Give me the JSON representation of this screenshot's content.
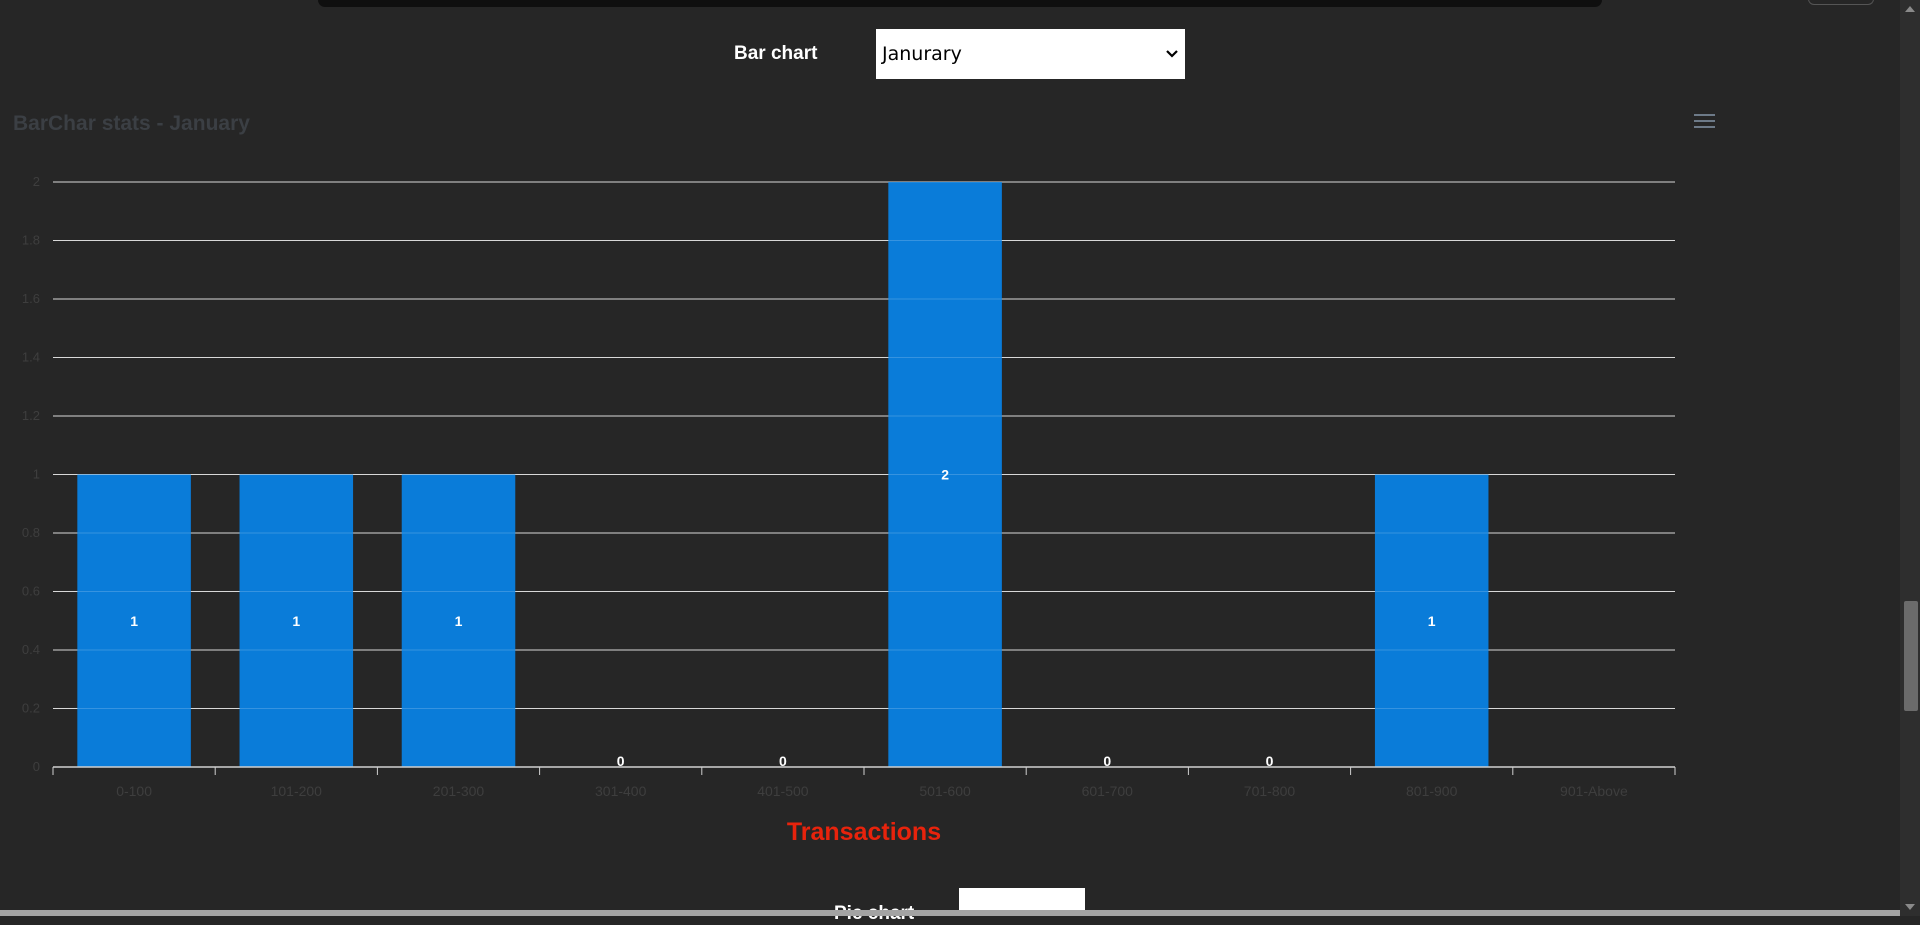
{
  "controls": {
    "bar_label": "Bar chart",
    "month_selected": "Janurary",
    "pie_label": "Pie chart"
  },
  "chart_data": {
    "type": "bar",
    "title": "BarChar stats - January",
    "categories": [
      "0-100",
      "101-200",
      "201-300",
      "301-400",
      "401-500",
      "501-600",
      "601-700",
      "701-800",
      "801-900",
      "901-Above"
    ],
    "values": [
      1,
      1,
      1,
      0,
      0,
      2,
      0,
      0,
      1,
      null
    ],
    "data_labels": [
      "1",
      "1",
      "1",
      "0",
      "0",
      "2",
      "0",
      "0",
      "1",
      ""
    ],
    "xlabel": "Transactions",
    "ylabel": "",
    "ylim": [
      0,
      2
    ],
    "yticks": [
      "0",
      "0.2",
      "0.4",
      "0.6",
      "0.8",
      "1",
      "1.2",
      "1.4",
      "1.6",
      "1.8",
      "2"
    ],
    "grid": true,
    "colors": {
      "bar": "#0a7cd9",
      "xlabel": "#e8230c",
      "title": "#3b3f44",
      "gridline": "#d0d0d0"
    }
  }
}
